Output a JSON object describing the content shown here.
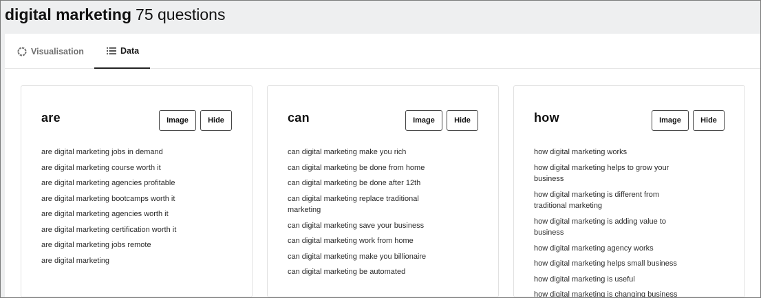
{
  "header": {
    "keyword": "digital marketing",
    "count_label": "75 questions"
  },
  "tabs": [
    {
      "label": "Visualisation",
      "icon": "spinner-circle-icon",
      "active": false
    },
    {
      "label": "Data",
      "icon": "list-icon",
      "active": true
    }
  ],
  "buttons": {
    "image_label": "Image",
    "hide_label": "Hide"
  },
  "cards": [
    {
      "title": "are",
      "questions": [
        "are digital marketing jobs in demand",
        "are digital marketing course worth it",
        "are digital marketing agencies profitable",
        "are digital marketing bootcamps worth it",
        "are digital marketing agencies worth it",
        "are digital marketing certification worth it",
        "are digital marketing jobs remote",
        "are digital marketing"
      ]
    },
    {
      "title": "can",
      "questions": [
        "can digital marketing make you rich",
        "can digital marketing be done from home",
        "can digital marketing be done after 12th",
        "can digital marketing replace traditional marketing",
        "can digital marketing save your business",
        "can digital marketing work from home",
        "can digital marketing make you billionaire",
        "can digital marketing be automated"
      ]
    },
    {
      "title": "how",
      "questions": [
        "how digital marketing works",
        "how digital marketing helps to grow your business",
        "how digital marketing is different from traditional marketing",
        "how digital marketing is adding value to business",
        "how digital marketing agency works",
        "how digital marketing helps small business",
        "how digital marketing is useful",
        "how digital marketing is changing business"
      ]
    }
  ],
  "colors": {
    "header_bg": "#eeeff0",
    "active_tab_underline": "#222222",
    "inactive_tab_text": "#6f6f6f"
  }
}
